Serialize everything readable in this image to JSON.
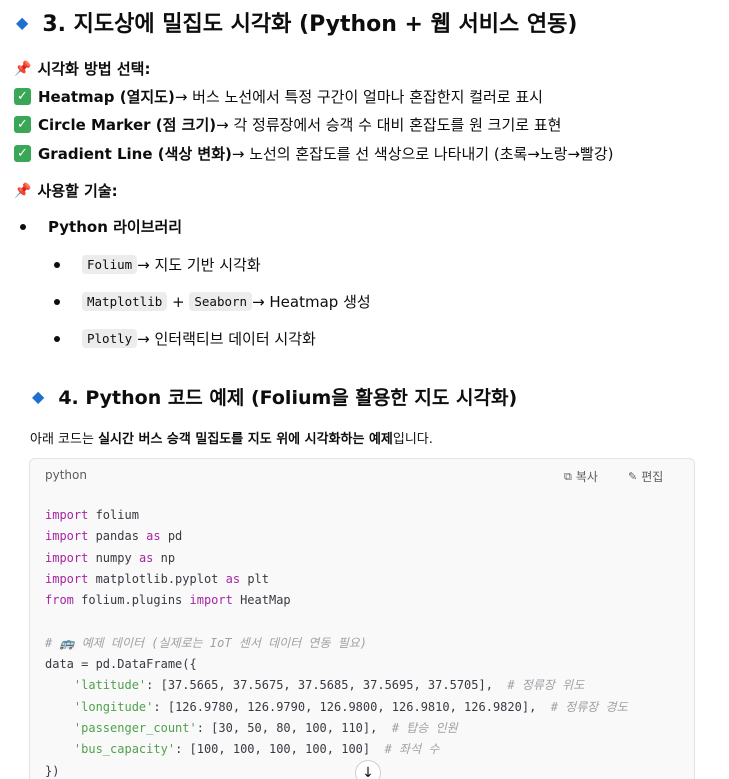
{
  "section3": {
    "title": "3. 지도상에 밀집도 시각화 (Python + 웹 서비스 연동)",
    "methods_heading": "시각화 방법 선택:",
    "methods": [
      {
        "name": "Heatmap (열지도)",
        "desc": " → 버스 노선에서 특정 구간이 얼마나 혼잡한지 컬러로 표시"
      },
      {
        "name": "Circle Marker (점 크기)",
        "desc": " → 각 정류장에서 승객 수 대비 혼잡도를 원 크기로 표현"
      },
      {
        "name": "Gradient Line (색상 변화)",
        "desc": " → 노선의 혼잡도를 선 색상으로 나타내기 (초록→노랑→빨강)"
      }
    ],
    "tech_heading": "사용할 기술:",
    "tech_group": "Python 라이브러리",
    "tech_items": [
      {
        "code1": "Folium",
        "text": " → 지도 기반 시각화"
      },
      {
        "code1": "Matplotlib",
        "plus": " + ",
        "code2": "Seaborn",
        "text": " → Heatmap 생성"
      },
      {
        "code1": "Plotly",
        "text": " → 인터랙티브 데이터 시각화"
      }
    ]
  },
  "section4": {
    "title": "4. Python 코드 예제 (Folium을 활용한 지도 시각화)",
    "intro_pre": "아래 코드는 ",
    "intro_bold": "실시간 버스 승객 밀집도를 지도 위에 시각화하는 예제",
    "intro_post": "입니다."
  },
  "codeblock": {
    "language": "python",
    "copy_label": "복사",
    "edit_label": "편집",
    "lines": [
      {
        "kw": "import",
        "rest": " folium"
      },
      {
        "kw": "import",
        "rest": " pandas ",
        "kw2": "as",
        "rest2": " pd"
      },
      {
        "kw": "import",
        "rest": " numpy ",
        "kw2": "as",
        "rest2": " np"
      },
      {
        "kw": "import",
        "rest": " matplotlib.pyplot ",
        "kw2": "as",
        "rest2": " plt"
      },
      {
        "kw": "from",
        "rest": " folium.plugins ",
        "kw2": "import",
        "rest2": " HeatMap"
      },
      {
        "comment": "# 🚌 예제 데이터 (실제로는 IoT 센서 데이터 연동 필요)"
      },
      {
        "plain": "data = pd.DataFrame({"
      },
      {
        "indent": "    ",
        "str": "'latitude'",
        "plain": ": [37.5665, 37.5675, 37.5685, 37.5695, 37.5705],  ",
        "comment": "# 정류장 위도"
      },
      {
        "indent": "    ",
        "str": "'longitude'",
        "plain": ": [126.9780, 126.9790, 126.9800, 126.9810, 126.9820],  ",
        "comment": "# 정류장 경도"
      },
      {
        "indent": "    ",
        "str": "'passenger_count'",
        "plain": ": [30, 50, 80, 100, 110],  ",
        "comment": "# 탑승 인원"
      },
      {
        "indent": "    ",
        "str": "'bus_capacity'",
        "plain": ": [100, 100, 100, 100, 100]  ",
        "comment": "# 좌석 수"
      },
      {
        "plain": "})"
      }
    ]
  }
}
